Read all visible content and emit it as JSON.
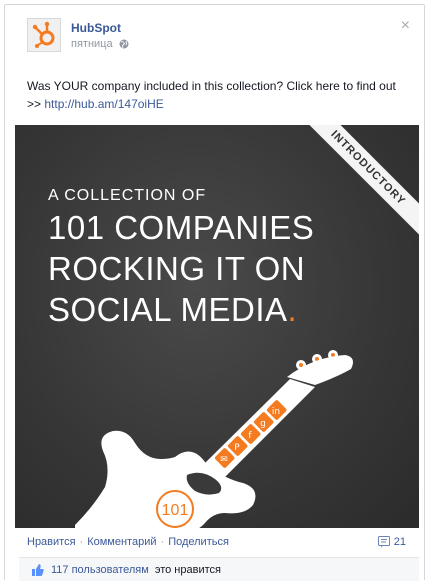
{
  "post": {
    "author": "HubSpot",
    "timestamp": "пятница",
    "privacy_icon": "globe-icon",
    "close_glyph": "×",
    "message_text": "Was YOUR company included in this collection? Click here to find out >> ",
    "message_link": "http://hub.am/147oiHE"
  },
  "image": {
    "ribbon": "INTRODUCTORY",
    "kicker": "A COLLECTION OF",
    "headline_line1": "101 COMPANIES",
    "headline_line2": "ROCKING IT ON",
    "headline_line3": "SOCIAL MEDIA",
    "headline_dot": ".",
    "badge": "101"
  },
  "actions": {
    "like": "Нравится",
    "comment": "Комментарий",
    "share": "Поделиться",
    "separator": "·",
    "comments_count": "21"
  },
  "likes": {
    "count": "117 пользователям",
    "text": "это нравится"
  },
  "colors": {
    "brand": "#f47b20",
    "link": "#3b5998"
  }
}
